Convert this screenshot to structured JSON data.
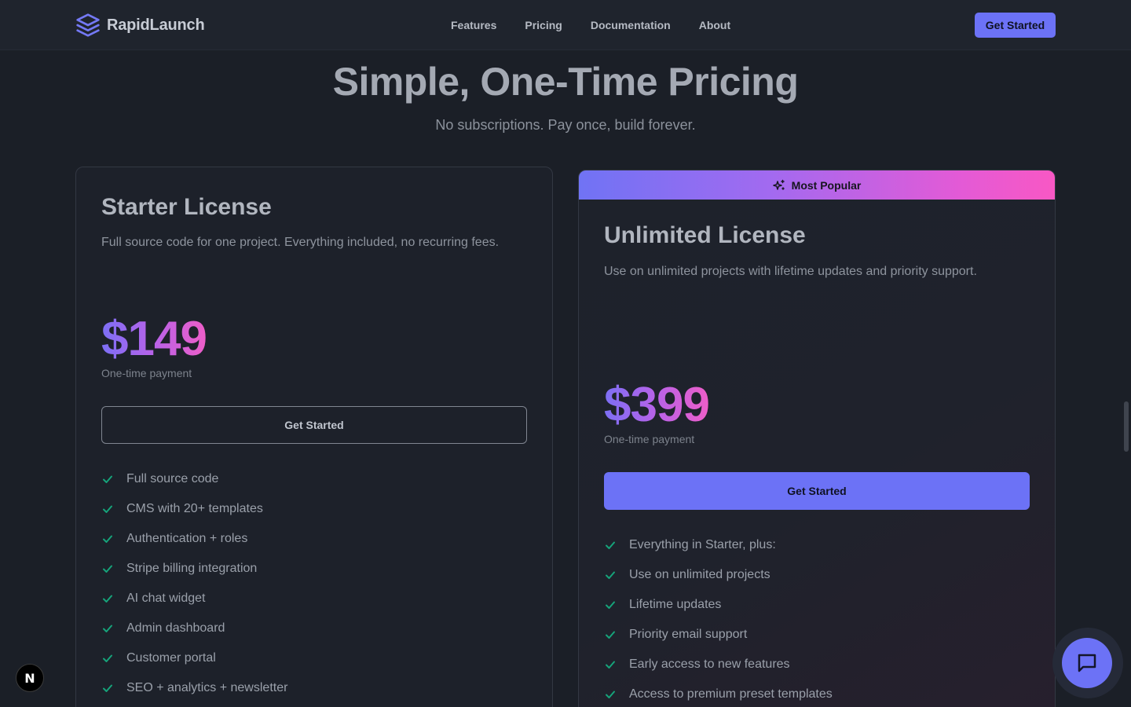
{
  "nav": {
    "brand": "RapidLaunch",
    "links": [
      "Features",
      "Pricing",
      "Documentation",
      "About"
    ],
    "cta": "Get Started"
  },
  "hero": {
    "title": "Simple, One-Time Pricing",
    "subtitle": "No subscriptions. Pay once, build forever."
  },
  "plans": [
    {
      "name": "Starter License",
      "description": "Full source code for one project. Everything included, no recurring fees.",
      "price": "$149",
      "price_note": "One-time payment",
      "cta": "Get Started",
      "features": [
        "Full source code",
        "CMS with 20+ templates",
        "Authentication + roles",
        "Stripe billing integration",
        "AI chat widget",
        "Admin dashboard",
        "Customer portal",
        "SEO + analytics + newsletter"
      ]
    },
    {
      "badge": "Most Popular",
      "name": "Unlimited License",
      "description": "Use on unlimited projects with lifetime updates and priority support.",
      "price": "$399",
      "price_note": "One-time payment",
      "cta": "Get Started",
      "features": [
        "Everything in Starter, plus:",
        "Use on unlimited projects",
        "Lifetime updates",
        "Priority email support",
        "Early access to new features",
        "Access to premium preset templates"
      ]
    }
  ],
  "dev_badge": "N",
  "colors": {
    "accent": "#6c72f6",
    "check": "#16a37a",
    "background": "#1b1f27",
    "gradient_start": "#7073f4",
    "gradient_end": "#f858c4"
  },
  "icons": {
    "logo": "stacked-layers-icon",
    "badge": "sparkles-icon",
    "feature": "check-icon",
    "chat": "chat-bubble-icon"
  }
}
